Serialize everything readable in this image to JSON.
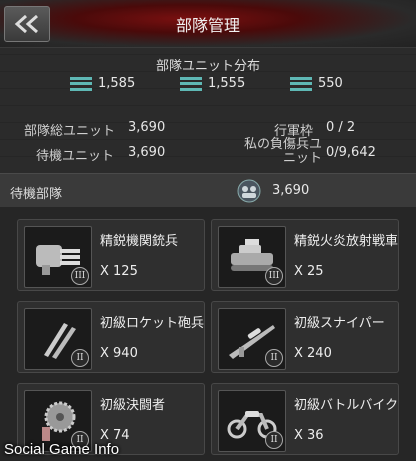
{
  "header": {
    "title": "部隊管理",
    "back_icon": "double-chevron-left-icon"
  },
  "distribution": {
    "title": "部隊ユニット分布",
    "items": [
      {
        "icon": "unit-bars-icon",
        "value": "1,585"
      },
      {
        "icon": "unit-bars-icon",
        "value": "1,555"
      },
      {
        "icon": "unit-bars-icon",
        "value": "550"
      }
    ]
  },
  "stats": {
    "total_label": "部隊総ユニット",
    "total_value": "3,690",
    "standby_label": "待機ユニット",
    "standby_value": "3,690",
    "march_label": "行軍枠",
    "march_value": "0 / 2",
    "wounded_label": "私の負傷兵ユニット",
    "wounded_value": "0/9,642"
  },
  "standby_bar": {
    "label": "待機部隊",
    "value": "3,690",
    "icon": "troops-icon"
  },
  "units": [
    {
      "name": "精鋭機関銃兵",
      "count": "X 125",
      "tier": "III",
      "icon": "gatling-gun-icon"
    },
    {
      "name": "精鋭火炎放射戦車",
      "count": "X 25",
      "tier": "III",
      "icon": "tank-icon"
    },
    {
      "name": "初級ロケット砲兵",
      "count": "X 940",
      "tier": "II",
      "icon": "rockets-icon"
    },
    {
      "name": "初級スナイパー",
      "count": "X 240",
      "tier": "II",
      "icon": "sniper-rifle-icon"
    },
    {
      "name": "初級決闘者",
      "count": "X 74",
      "tier": "II",
      "icon": "saw-blade-icon"
    },
    {
      "name": "初級バトルバイク",
      "count": "X 36",
      "tier": "II",
      "icon": "motorbike-icon"
    }
  ],
  "watermark": "Social Game Info",
  "colors": {
    "accent": "#5fb8b5",
    "header_red": "#7a1010"
  }
}
